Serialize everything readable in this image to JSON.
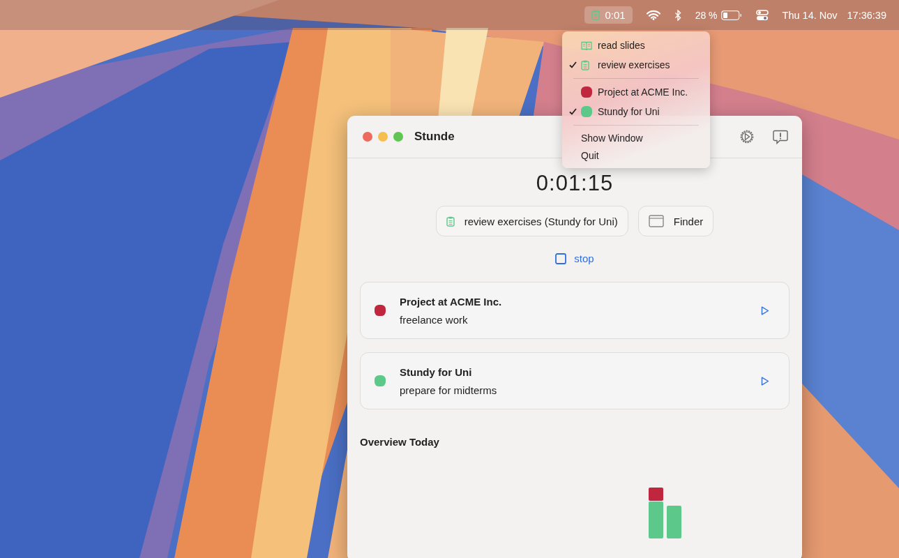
{
  "menubar": {
    "timer": {
      "label": "0:01",
      "selected": true
    },
    "battery": "28 %",
    "date": "Thu 14. Nov",
    "time": "17:36:39"
  },
  "menu": {
    "tasks": [
      {
        "label": "read slides",
        "kind": "book",
        "checked": false
      },
      {
        "label": "review exercises",
        "kind": "clipboard",
        "checked": true
      }
    ],
    "projects": [
      {
        "label": "Project at ACME Inc.",
        "color": "#c0263d",
        "checked": false
      },
      {
        "label": "Stundy for Uni",
        "color": "#5cc98a",
        "checked": true
      }
    ],
    "actions": [
      "Show Window",
      "Quit"
    ]
  },
  "window": {
    "title": "Stunde",
    "timer": "0:01:15",
    "current_task": "review exercises (Stundy for Uni)",
    "app": "Finder",
    "stop": "stop",
    "projects": [
      {
        "name": "Project at ACME Inc.",
        "description": "freelance work",
        "color": "#c0263d"
      },
      {
        "name": "Stundy for Uni",
        "description": "prepare for midterms",
        "color": "#5cc98a"
      }
    ],
    "overview_title": "Overview Today"
  }
}
